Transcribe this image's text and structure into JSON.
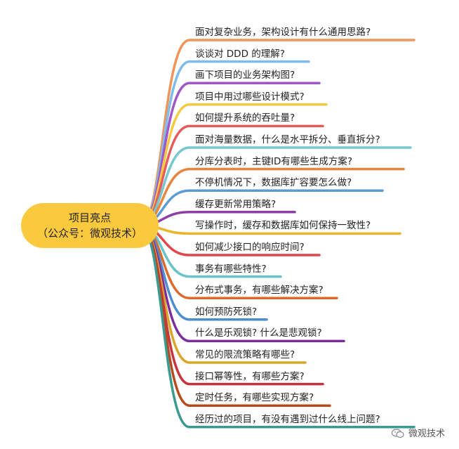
{
  "root": {
    "title": "项目亮点",
    "subtitle": "（公众号：微观技术）"
  },
  "branches": [
    {
      "label": "面对复杂业务，架构设计有什么通用思路?",
      "color": "#F0955A"
    },
    {
      "label": "谈谈对 DDD 的理解?",
      "color": "#7FBCEA"
    },
    {
      "label": "画下项目的业务架构图?",
      "color": "#A156C6"
    },
    {
      "label": "项目中用过哪些设计模式?",
      "color": "#F4C943"
    },
    {
      "label": "如何提升系统的吞吐量?",
      "color": "#E65C5C"
    },
    {
      "label": "面对海量数据，什么是水平拆分、垂直拆分?",
      "color": "#78C7CE"
    },
    {
      "label": "分库分表时，主键ID有哪些生成方案?",
      "color": "#E8843E"
    },
    {
      "label": "不停机情况下，数据库扩容要怎么做?",
      "color": "#5B9BD5"
    },
    {
      "label": "缓存更新常用策略?",
      "color": "#8E3EA8"
    },
    {
      "label": "写操作时，缓存和数据库如何保持一致性?",
      "color": "#E9B52F"
    },
    {
      "label": "如何减少接口的响应时间?",
      "color": "#E0474C"
    },
    {
      "label": "事务有哪些特性?",
      "color": "#66C3C7"
    },
    {
      "label": "分布式事务，有哪些解决方案?",
      "color": "#DB6B2C"
    },
    {
      "label": "如何预防死锁?",
      "color": "#4E8CD0"
    },
    {
      "label": "什么是乐观锁? 什么是悲观锁?",
      "color": "#7B2E99"
    },
    {
      "label": "常见的限流策略有哪些?",
      "color": "#D9A62A"
    },
    {
      "label": "接口幂等性，有哪些方案?",
      "color": "#C8343B"
    },
    {
      "label": "定时任务，有哪些实现方案?",
      "color": "#B84A1D"
    },
    {
      "label": "经历过的项目，有没有遇到过什么线上问题?",
      "color": "#3A9A92"
    }
  ],
  "watermark": {
    "text": "微观技术",
    "icon": "wechat-icon"
  }
}
